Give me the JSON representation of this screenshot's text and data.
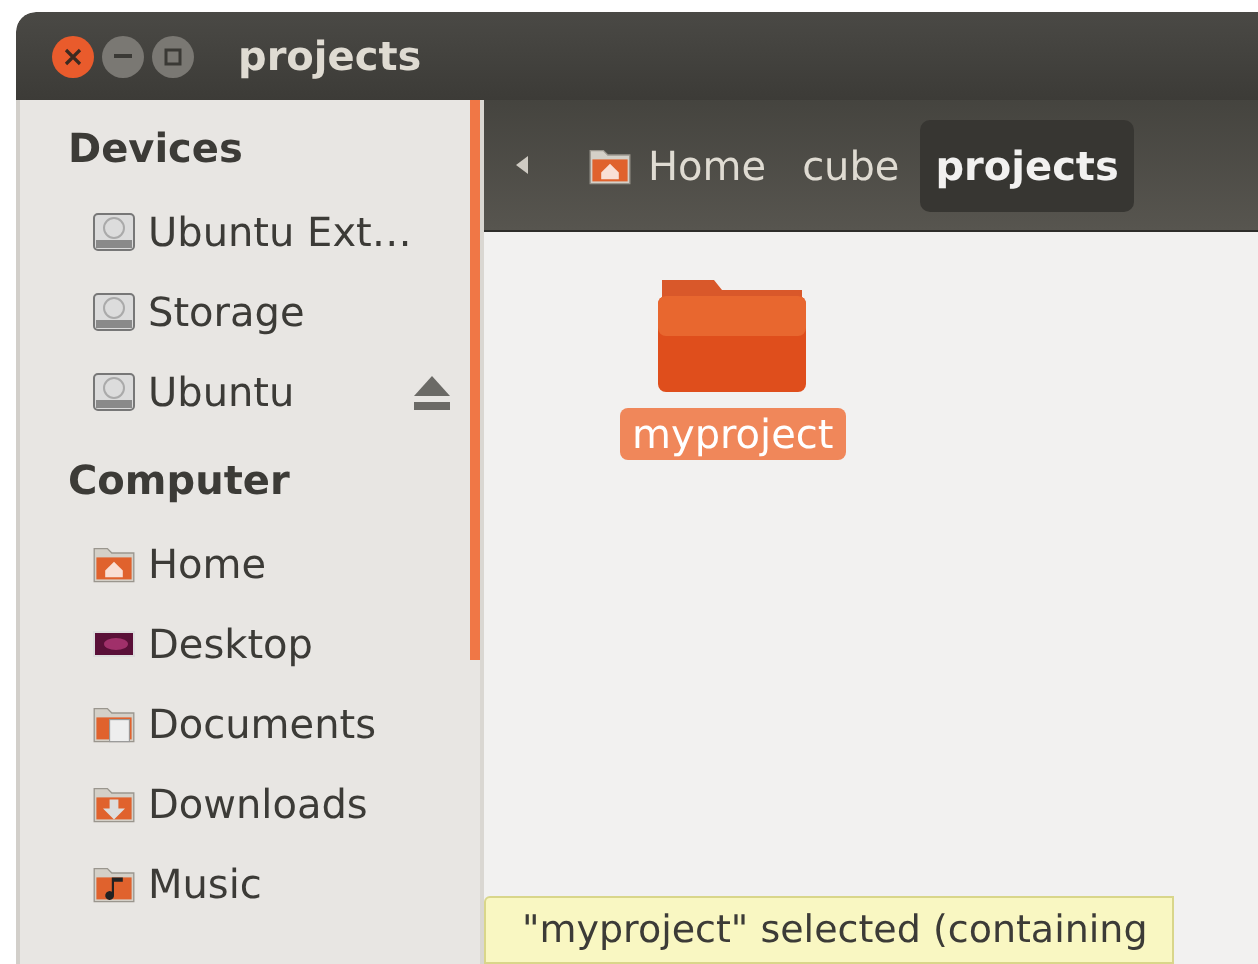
{
  "window": {
    "title": "projects"
  },
  "sidebar": {
    "sections": [
      {
        "heading": "Devices",
        "items": [
          {
            "label": "Ubuntu Ext…",
            "kind": "drive",
            "eject": false
          },
          {
            "label": "Storage",
            "kind": "drive",
            "eject": false
          },
          {
            "label": "Ubuntu",
            "kind": "drive",
            "eject": true
          }
        ]
      },
      {
        "heading": "Computer",
        "items": [
          {
            "label": "Home",
            "kind": "home",
            "eject": false
          },
          {
            "label": "Desktop",
            "kind": "desktop",
            "eject": false
          },
          {
            "label": "Documents",
            "kind": "documents",
            "eject": false
          },
          {
            "label": "Downloads",
            "kind": "downloads",
            "eject": false
          },
          {
            "label": "Music",
            "kind": "music",
            "eject": false
          }
        ]
      }
    ]
  },
  "pathbar": [
    {
      "label": "Home",
      "kind": "home",
      "selected": false
    },
    {
      "label": "cube",
      "kind": "plain",
      "selected": false
    },
    {
      "label": "projects",
      "kind": "plain",
      "selected": true
    }
  ],
  "files": [
    {
      "name": "myproject",
      "selected": true
    }
  ],
  "status_bar": {
    "text": "\"myproject\" selected (containing"
  }
}
